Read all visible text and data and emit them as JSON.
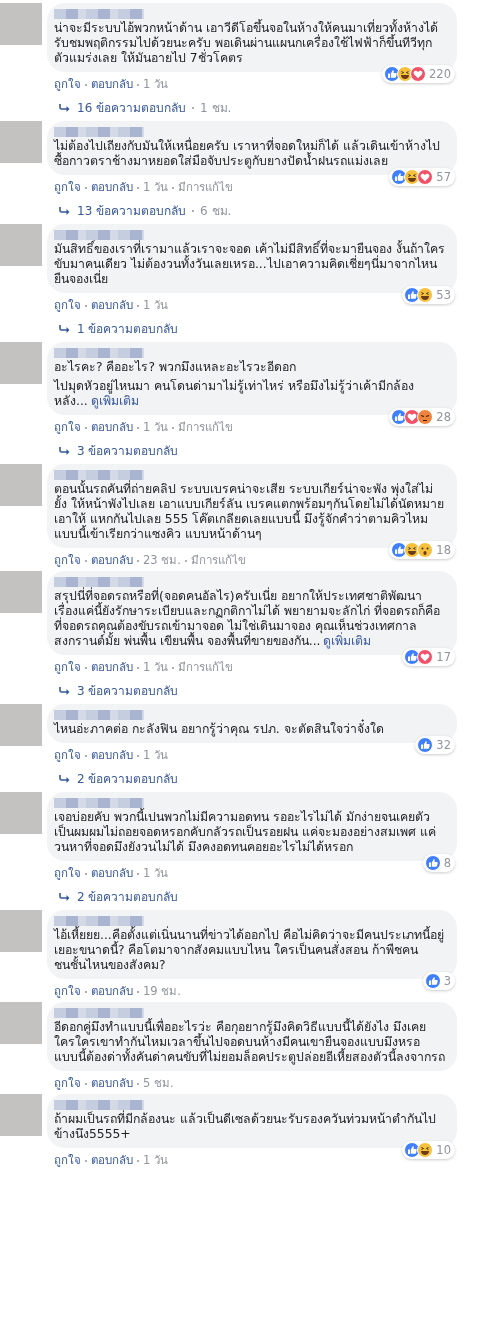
{
  "comments": [
    {
      "text": [
        "น่าจะมีระบบไอ้พวกหน้าด้าน เอาวีดีโอขึ้นจอในห้างให้คนมาเที่ยวทั้งห้างได้รับชมพฤติกรรมไปด้วยนะครับ พอเดินผ่านแผนกเครื่องใช้ไฟฟ้าก็ขึ้นทีวีทุกตัวแมร่งเลย ให้มันอายไป 7ชั่วโคตร"
      ],
      "reactions": [
        {
          "kind": "like"
        },
        {
          "kind": "haha"
        },
        {
          "kind": "love"
        }
      ],
      "count": "220",
      "like": "ถูกใจ",
      "reply": "ตอบกลับ",
      "time": "1 วัน",
      "replies": {
        "text": "16 ข้อความตอบกลับ",
        "time": "1 ชม."
      }
    },
    {
      "text": [
        "ไม่ต้องไปเถียงกับมันให้เหนื่อยครับ เราหาที่จอดใหม่ก็ได้ แล้วเดินเข้าห้างไปซื้อกาวตราช้างมาหยอดใส่มือจับประตูกับยางปัดน้ำฝนรถแม่งเลย"
      ],
      "reactions": [
        {
          "kind": "like"
        },
        {
          "kind": "haha"
        },
        {
          "kind": "love"
        }
      ],
      "count": "57",
      "like": "ถูกใจ",
      "reply": "ตอบกลับ",
      "time": "1 วัน",
      "edited": "มีการแก้ไข",
      "replies": {
        "text": "13 ข้อความตอบกลับ",
        "time": "6 ชม."
      }
    },
    {
      "text": [
        "มันสิทธิ์ของเราที่เรามาแล้วเราจะจอด เค้าไม่มีสิทธิ์ที่จะมายืนจอง งั้นถ้าใครขับมาคนเดียว ไม่ต้องวนทั้งวันเลยเหรอ...ไปเอาความคิดเชี่ยๆนี่มาจากไหน ยืนจองเนี่ย"
      ],
      "reactions": [
        {
          "kind": "like"
        },
        {
          "kind": "haha"
        }
      ],
      "count": "53",
      "like": "ถูกใจ",
      "reply": "ตอบกลับ",
      "time": "1 วัน",
      "replies": {
        "text": "1 ข้อความตอบกลับ"
      }
    },
    {
      "text": [
        "อะไรคะ? คืออะไร? พวกมึงแหละอะไรวะอีดอก",
        "ไปมุดหัวอยู่ไหนมา คนโดนด่ามาไม่รู้เท่าไหร่ หรือมึงไม่รู้ว่าเค้ามีกล้องหลัง..."
      ],
      "more": "ดูเพิ่มเติม",
      "reactions": [
        {
          "kind": "like"
        },
        {
          "kind": "love"
        },
        {
          "kind": "angry"
        }
      ],
      "count": "28",
      "like": "ถูกใจ",
      "reply": "ตอบกลับ",
      "time": "1 วัน",
      "edited": "มีการแก้ไข",
      "replies": {
        "text": "3 ข้อความตอบกลับ"
      }
    },
    {
      "text": [
        "ตอนนั้นรถคันที่ถ่ายคลิป ระบบเบรคน่าจะเสีย ระบบเกียร์น่าจะพัง พุ่งใส่ไม่ยั้ง ให้หน้าพังไปเลย เอาแบบเกียร์ลัน เบรคแตกพร้อมๆกันโดยไม่ได้นัดหมาย เอาให้ แหกกันไปเลย 555 โค๊ตเกลียดเลยแบบนี้ มึงรู้จักคำว่าตามคิวไหมแบบนี้เข้าเรียกว่าแซงคิว แบบหน้าด้านๆ"
      ],
      "reactions": [
        {
          "kind": "like"
        },
        {
          "kind": "haha"
        },
        {
          "kind": "wow"
        }
      ],
      "count": "18",
      "like": "ถูกใจ",
      "reply": "ตอบกลับ",
      "time": "23 ชม.",
      "edited": "มีการแก้ไข"
    },
    {
      "text": [
        "สรุปนี่ที่จอดรถหรือที่(จอดคนอัลไร)ครับเนี่ย อยากให้ประเทศชาติพัฒนาเรื่องแค่นี้ยังรักษาระเบียบและกฏกติกาไม่ได้ พยายามจะลักไก่ ที่จอดรถก็คือที่จอดรถคุณต้องขับรถเข้ามาจอด ไม่ใช่เดินมาจอง คุณเห็นช่วงเทศกาลสงกรานต์มั้ย พ่นพื้น เขียนพื้น จองพื้นที่ขายของกัน..."
      ],
      "more": "ดูเพิ่มเติม",
      "reactions": [
        {
          "kind": "like"
        },
        {
          "kind": "love"
        }
      ],
      "count": "17",
      "like": "ถูกใจ",
      "reply": "ตอบกลับ",
      "time": "1 วัน",
      "edited": "มีการแก้ไข",
      "replies": {
        "text": "3 ข้อความตอบกลับ"
      }
    },
    {
      "text": [
        "ไหนอ่ะภาคต่อ กะลังฟิน อยากรู้ว่าคุณ รปภ. จะตัดสินใจว่าจั๋งใด"
      ],
      "reactions": [
        {
          "kind": "like"
        }
      ],
      "count": "32",
      "like": "ถูกใจ",
      "reply": "ตอบกลับ",
      "time": "1 วัน",
      "replies": {
        "text": "2 ข้อความตอบกลับ"
      }
    },
    {
      "text": [
        "เจอบ่อยคับ พวกนี้เปนพวกไม่มีความอดทน รออะไรไม่ได้ มักง่ายจนเคยตัว เป็นผมผมไม่ถอยจอดหรอกคับกลัวรถเป็นรอยฝน แค่จะมองอย่างสมเพศ แค่วนหาที่จอดมึงยังวนไม่ได้ มึงคงอดทนคอยอะไรไม่ได้หรอก"
      ],
      "reactions": [
        {
          "kind": "like"
        }
      ],
      "count": "8",
      "like": "ถูกใจ",
      "reply": "ตอบกลับ",
      "time": "1 วัน",
      "replies": {
        "text": "2 ข้อความตอบกลับ"
      }
    },
    {
      "text": [
        "ไอ้เหี้ยยย...คือตั้งแต่เนิ่นนานที่ข่าวได้ออกไป คือไม่คิดว่าจะมีคนประเภทนี้อยู่เยอะขนาดนี้? คือโตมาจากสังคมแบบไหน ใครเป็นคนสั่งสอน ก้าพืชคนชนชั้นไหนของสังคม?"
      ],
      "reactions": [
        {
          "kind": "like"
        }
      ],
      "count": "3",
      "like": "ถูกใจ",
      "reply": "ตอบกลับ",
      "time": "19 ชม."
    },
    {
      "text": [
        "อีดอกคู่มึงทำแบบนี้เพื่ออะไรว่ะ คือกุอยากรู้มึงคิดวิธีแบบนี้ได้ยังไง มึงเคยใครใครเขาทำกันไหมเวลาขึ้นไปจอดบนห้างมีคนเขายืนจองแบบมึงหรอ แบบนี้ต้องด่าทั้งคันด่าคนขับที่ไม่ยอมล็อคประตูปล่อยอีเหี้ยสองตัวนี้ลงจากรถ"
      ],
      "like": "ถูกใจ",
      "reply": "ตอบกลับ",
      "time": "5 ชม."
    },
    {
      "text": [
        "ถ้าผมเป็นรถที่มีกล้องนะ แล้วเป็นดีเซลด้วยนะรับรองควันท่วมหน้าตำกันไปข้างนึง5555+"
      ],
      "reactions": [
        {
          "kind": "like"
        },
        {
          "kind": "haha"
        }
      ],
      "count": "10",
      "like": "ถูกใจ",
      "reply": "ตอบกลับ",
      "time": "1 วัน"
    }
  ]
}
